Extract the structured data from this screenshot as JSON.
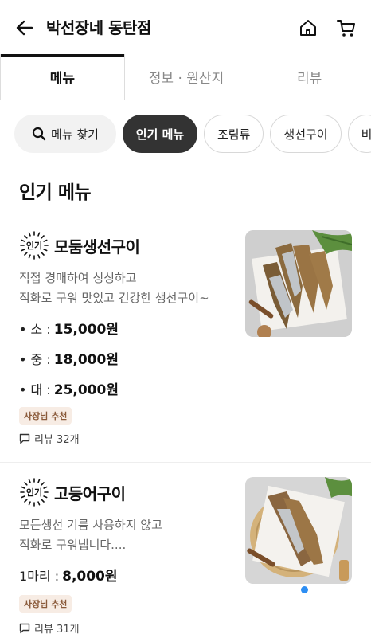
{
  "header": {
    "title": "박선장네 동탄점",
    "back_icon": "arrow-left-icon",
    "home_icon": "home-icon",
    "cart_icon": "cart-icon"
  },
  "tabs": [
    {
      "label": "메뉴",
      "active": true
    },
    {
      "label": "정보 · 원산지",
      "active": false
    },
    {
      "label": "리뷰",
      "active": false
    }
  ],
  "chips": {
    "search_label": "메뉴 찾기",
    "items": [
      {
        "label": "인기 메뉴",
        "active": true
      },
      {
        "label": "조림류",
        "active": false
      },
      {
        "label": "생선구이",
        "active": false
      },
      {
        "label": "비",
        "active": false
      }
    ]
  },
  "section": {
    "title": "인기 메뉴"
  },
  "menu_items": [
    {
      "badge": "인기",
      "name": "모둠생선구이",
      "desc_line1": "직접 경매하여 싱싱하고",
      "desc_line2": "직화로 구워 맛있고 건강한 생선구이~",
      "prices": [
        {
          "size": "• 소 :",
          "price": "15,000원"
        },
        {
          "size": "• 중 :",
          "price": "18,000원"
        },
        {
          "size": "• 대 :",
          "price": "25,000원"
        }
      ],
      "owner_tag": "사장님 추천",
      "review": "리뷰 32개"
    },
    {
      "badge": "인기",
      "name": "고등어구이",
      "desc_line1": "모든생선 기름 사용하지 않고",
      "desc_line2": "직화로 구워냅니다....",
      "prices": [
        {
          "size": "1마리 :",
          "price": "8,000원"
        }
      ],
      "owner_tag": "사장님 추천",
      "review": "리뷰 31개"
    }
  ],
  "colors": {
    "accent_dark": "#333333",
    "tag_bg": "#f7ece4",
    "tag_text": "#8a5a3a",
    "page_indicator": "#2d8ef3"
  }
}
